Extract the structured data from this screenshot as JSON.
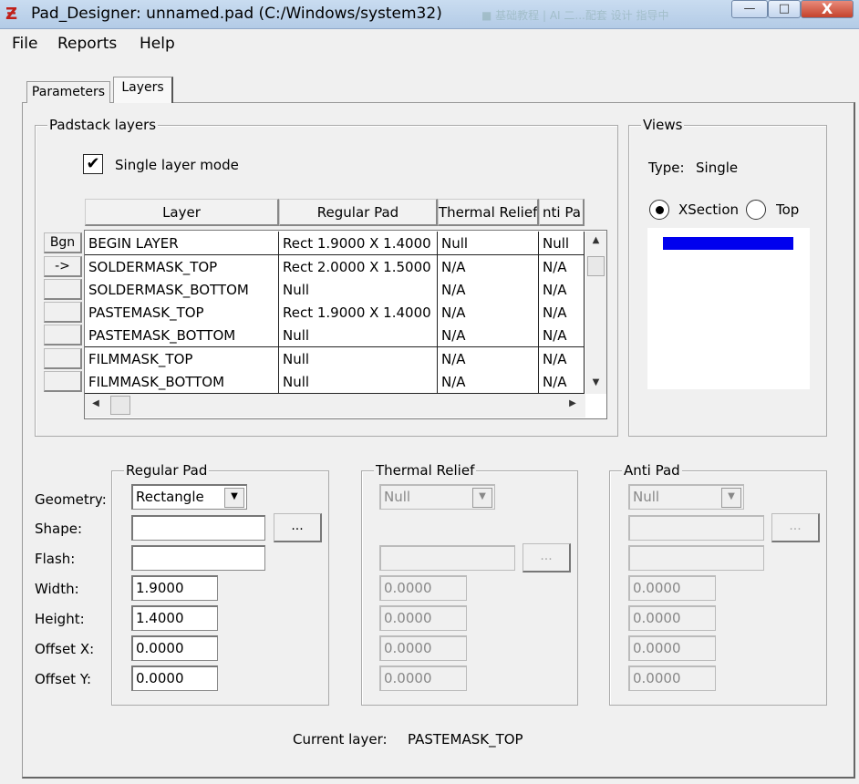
{
  "window": {
    "title": "Pad_Designer: unnamed.pad (C:/Windows/system32)",
    "background_task": "■ 基础教程 | AI 二...配套 设计 指导中",
    "minimize": "—",
    "maximize": "□",
    "close": "X"
  },
  "menu": [
    "File",
    "Reports",
    "Help"
  ],
  "tabs": [
    "Parameters",
    "Layers"
  ],
  "padstack": {
    "title": "Padstack layers",
    "single_layer_mode_label": "Single layer mode",
    "single_layer_mode_checked": true,
    "columns": [
      "Layer",
      "Regular Pad",
      "Thermal Relief",
      "nti Pa"
    ],
    "row_buttons": [
      "Bgn",
      "->",
      "",
      "",
      "",
      "",
      ""
    ],
    "rows": [
      [
        "BEGIN LAYER",
        "Rect 1.9000 X 1.4000",
        "Null",
        "Null"
      ],
      [
        "SOLDERMASK_TOP",
        "Rect 2.0000 X 1.5000",
        "N/A",
        "N/A"
      ],
      [
        "SOLDERMASK_BOTTOM",
        "Null",
        "N/A",
        "N/A"
      ],
      [
        "PASTEMASK_TOP",
        "Rect 1.9000 X 1.4000",
        "N/A",
        "N/A"
      ],
      [
        "PASTEMASK_BOTTOM",
        "Null",
        "N/A",
        "N/A"
      ],
      [
        "FILMMASK_TOP",
        "Null",
        "N/A",
        "N/A"
      ],
      [
        "FILMMASK_BOTTOM",
        "Null",
        "N/A",
        "N/A"
      ]
    ]
  },
  "views": {
    "title": "Views",
    "type_label": "Type:",
    "type_value": "Single",
    "radio_xsection": "XSection",
    "radio_top": "Top",
    "selected": "XSection",
    "bar_color": "#0000ee"
  },
  "form": {
    "labels": [
      "Geometry:",
      "Shape:",
      "Flash:",
      "Width:",
      "Height:",
      "Offset X:",
      "Offset Y:"
    ],
    "regular": {
      "title": "Regular Pad",
      "geometry": "Rectangle",
      "shape": "",
      "flash": "",
      "width": "1.9000",
      "height": "1.4000",
      "offset_x": "0.0000",
      "offset_y": "0.0000",
      "browse": "..."
    },
    "thermal": {
      "title": "Thermal Relief",
      "geometry": "Null",
      "flash": "",
      "width": "0.0000",
      "height": "0.0000",
      "offset_x": "0.0000",
      "offset_y": "0.0000",
      "browse": "..."
    },
    "anti": {
      "title": "Anti Pad",
      "geometry": "Null",
      "shape": "",
      "flash": "",
      "width": "0.0000",
      "height": "0.0000",
      "offset_x": "0.0000",
      "offset_y": "0.0000",
      "browse": "..."
    }
  },
  "status": {
    "current_layer_label": "Current layer:",
    "current_layer_value": "PASTEMASK_TOP"
  }
}
